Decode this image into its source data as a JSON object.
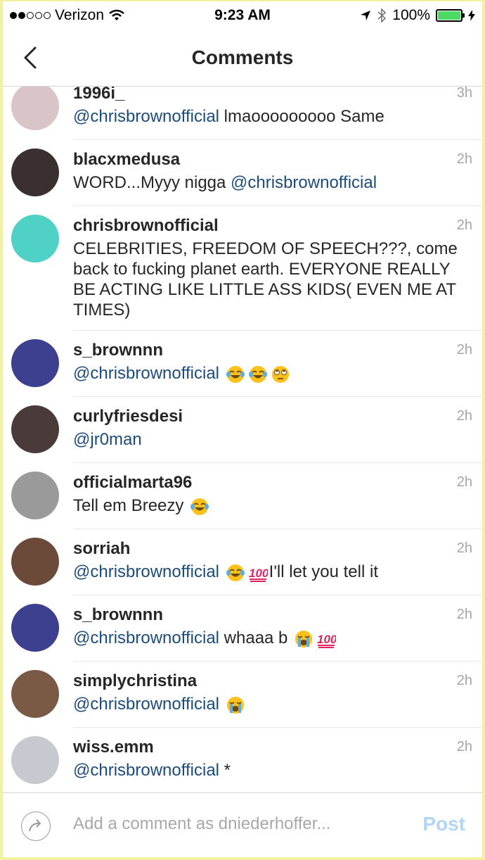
{
  "status_bar": {
    "carrier": "Verizon",
    "signal_dots": [
      true,
      true,
      false,
      false,
      false
    ],
    "time": "9:23 AM",
    "battery": "100%",
    "icons": [
      "wifi-icon",
      "location-arrow-icon",
      "bluetooth-icon",
      "battery-icon",
      "charging-bolt-icon"
    ]
  },
  "nav": {
    "title": "Comments",
    "back_icon": "chevron-left-icon"
  },
  "comments": [
    {
      "user": "1996i_",
      "time": "3h",
      "parts": [
        {
          "t": "mention",
          "v": "@chrisbrownofficial"
        },
        {
          "t": "text",
          "v": " lmaooooooooo Same"
        }
      ]
    },
    {
      "user": "blacxmedusa",
      "time": "2h",
      "parts": [
        {
          "t": "text",
          "v": "WORD...Myyy nigga "
        },
        {
          "t": "mention",
          "v": "@chrisbrownofficial"
        }
      ]
    },
    {
      "user": "chrisbrownofficial",
      "time": "2h",
      "parts": [
        {
          "t": "text",
          "v": "CELEBRITIES, FREEDOM OF SPEECH???, come back to fucking planet earth. EVERYONE REALLY BE ACTING LIKE LITTLE ASS KIDS( EVEN ME AT TIMES)"
        }
      ]
    },
    {
      "user": "s_brownnn",
      "time": "2h",
      "parts": [
        {
          "t": "mention",
          "v": "@chrisbrownofficial"
        },
        {
          "t": "text",
          "v": " "
        },
        {
          "t": "emoji",
          "v": "joy"
        },
        {
          "t": "emoji",
          "v": "joy"
        },
        {
          "t": "emoji",
          "v": "eyeroll"
        }
      ]
    },
    {
      "user": "curlyfriesdesi",
      "time": "2h",
      "parts": [
        {
          "t": "mention",
          "v": "@jr0man"
        }
      ]
    },
    {
      "user": "officialmarta96",
      "time": "2h",
      "parts": [
        {
          "t": "text",
          "v": "Tell em Breezy "
        },
        {
          "t": "emoji",
          "v": "joy"
        }
      ]
    },
    {
      "user": "sorriah",
      "time": "2h",
      "parts": [
        {
          "t": "mention",
          "v": "@chrisbrownofficial"
        },
        {
          "t": "text",
          "v": " "
        },
        {
          "t": "emoji",
          "v": "joy"
        },
        {
          "t": "emoji",
          "v": "hundred"
        },
        {
          "t": "text",
          "v": "I'll let you tell it"
        }
      ]
    },
    {
      "user": "s_brownnn",
      "time": "2h",
      "parts": [
        {
          "t": "mention",
          "v": "@chrisbrownofficial"
        },
        {
          "t": "text",
          "v": " whaaa b "
        },
        {
          "t": "emoji",
          "v": "sob"
        },
        {
          "t": "emoji",
          "v": "hundred"
        }
      ]
    },
    {
      "user": "simplychristina",
      "time": "2h",
      "parts": [
        {
          "t": "mention",
          "v": "@chrisbrownofficial"
        },
        {
          "t": "text",
          "v": " "
        },
        {
          "t": "emoji",
          "v": "sob"
        }
      ]
    },
    {
      "user": "wiss.emm",
      "time": "2h",
      "parts": [
        {
          "t": "mention",
          "v": "@chrisbrownofficial"
        },
        {
          "t": "text",
          "v": " *"
        }
      ]
    }
  ],
  "avatar_colors": [
    "#d9c5c8",
    "#3a3030",
    "#4fd1c5",
    "#3d3f8f",
    "#4a3a3a",
    "#9a9a9a",
    "#6b4a3a",
    "#3d3f8f",
    "#7a5a45",
    "#c8c8d0"
  ],
  "composer": {
    "share_icon": "share-arrow-icon",
    "placeholder": "Add a comment as dniederhoffer...",
    "post_label": "Post"
  }
}
